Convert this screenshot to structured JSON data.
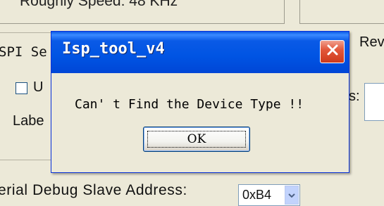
{
  "background": {
    "top_text": "Roughly Speed: 48 KHz",
    "spi_group_label": "SPI Se",
    "checkbox_label": "U",
    "label_text": "Labe",
    "right_label": "Reve",
    "colon_text": "s:",
    "serial_label": "erial Debug Slave Address:",
    "slave_address_value": "0xB4"
  },
  "dialog": {
    "title": "Isp_tool_v4",
    "message": "Can' t Find the Device Type !!",
    "ok_label": "OK"
  },
  "icons": {
    "close": "close-icon",
    "dropdown": "chevron-down-icon"
  },
  "colors": {
    "titlebar": "#0054e3",
    "close_button": "#e2583b",
    "window_bg": "#ece9d8"
  }
}
